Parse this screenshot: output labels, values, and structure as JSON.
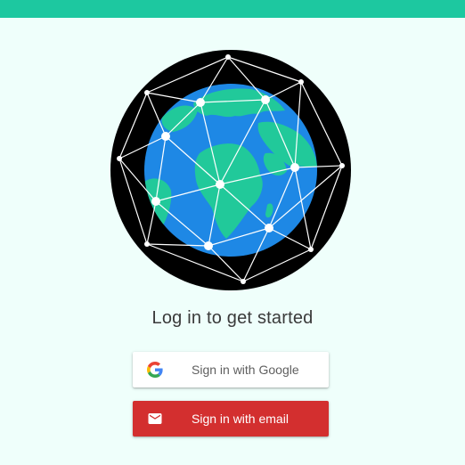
{
  "colors": {
    "top_bar": "#1dc8a0",
    "background": "#effffb",
    "globe_ocean": "#1e88e5",
    "globe_land": "#21c99a",
    "globe_frame": "#000000",
    "network": "#ffffff",
    "email_button": "#d32f2f"
  },
  "hero": {
    "icon": "globe-network-icon"
  },
  "headline": "Log in to get started",
  "buttons": {
    "google": {
      "label": "Sign in with Google",
      "icon": "google-logo-icon"
    },
    "email": {
      "label": "Sign in with email",
      "icon": "mail-icon"
    }
  }
}
